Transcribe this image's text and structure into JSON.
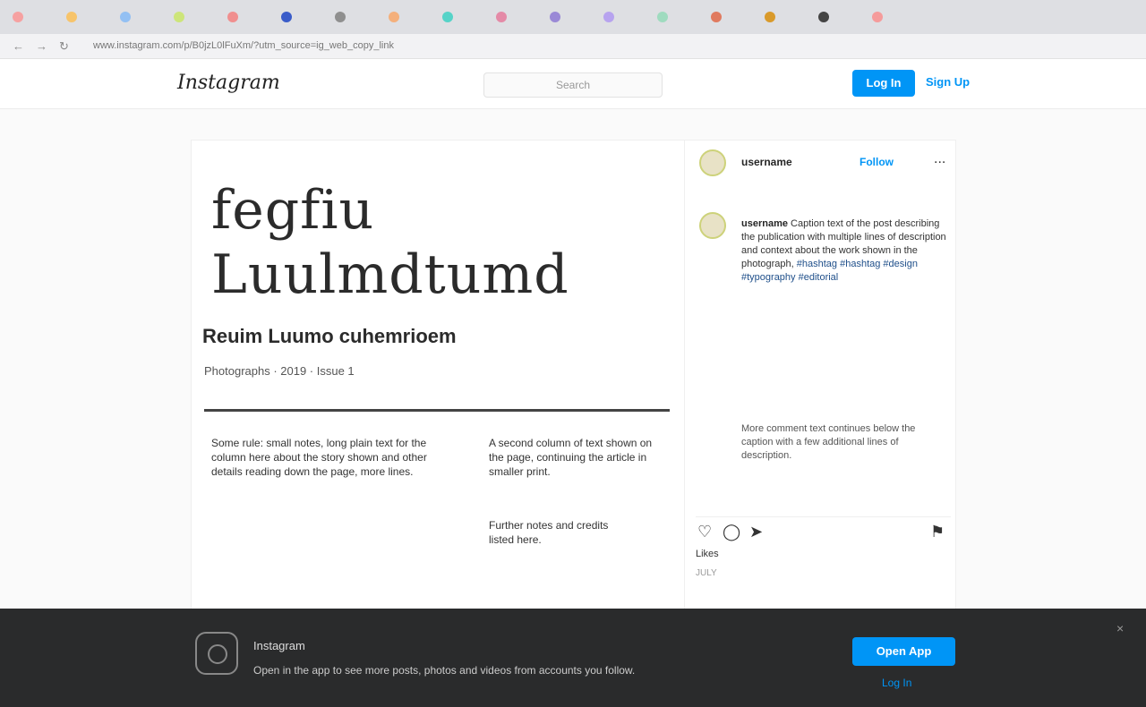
{
  "browser": {
    "url": "www.instagram.com/p/B0jzL0lFuXm/?utm_source=ig_web_copy_link",
    "tab_colors": [
      "#f6a1a1",
      "#f7c46b",
      "#93c0f3",
      "#cde57a",
      "#f08f8f",
      "#3a5cc9",
      "#8f8f8f",
      "#f4b07c",
      "#56d3c8",
      "#e48aa7",
      "#9a89d6",
      "#b7a3ef",
      "#9fdbbf",
      "#e07a5f",
      "#d99a2b",
      "#444444",
      "#f59b9b"
    ]
  },
  "header": {
    "logo": "Instagram",
    "search_placeholder": "Search",
    "login_label": "Log In",
    "signup_label": "Sign Up"
  },
  "post": {
    "title_line1": "fegfiu",
    "title_line2": "Luulmdtumd",
    "subtitle": "Reuim Luumo cuhemrioem",
    "byline": "Photographs · 2019 · Issue 1",
    "col_left": "Some rule: small notes, long plain text for the column here about the story shown and other details reading down the page, more lines.",
    "col_right": "A second column of text shown on the page, continuing the article in smaller print.",
    "col_right_2": "Further notes and credits listed here."
  },
  "side": {
    "username": "username",
    "follow_label": "Follow",
    "more_label": "...",
    "caption_user": "username",
    "caption_body": "Caption text of the post describing the publication with multiple lines of description and context about the work shown in the photograph,",
    "caption_tags": "#hashtag #hashtag #design #typography #editorial",
    "caption_2": "More comment text continues below the caption with a few additional lines of description.",
    "likes": "Likes",
    "date": "JULY"
  },
  "banner": {
    "title": "Instagram",
    "text": "Open in the app to see more posts, photos and videos from accounts you follow.",
    "button_label": "Open App",
    "link_label": "Log In",
    "close_label": "×"
  }
}
